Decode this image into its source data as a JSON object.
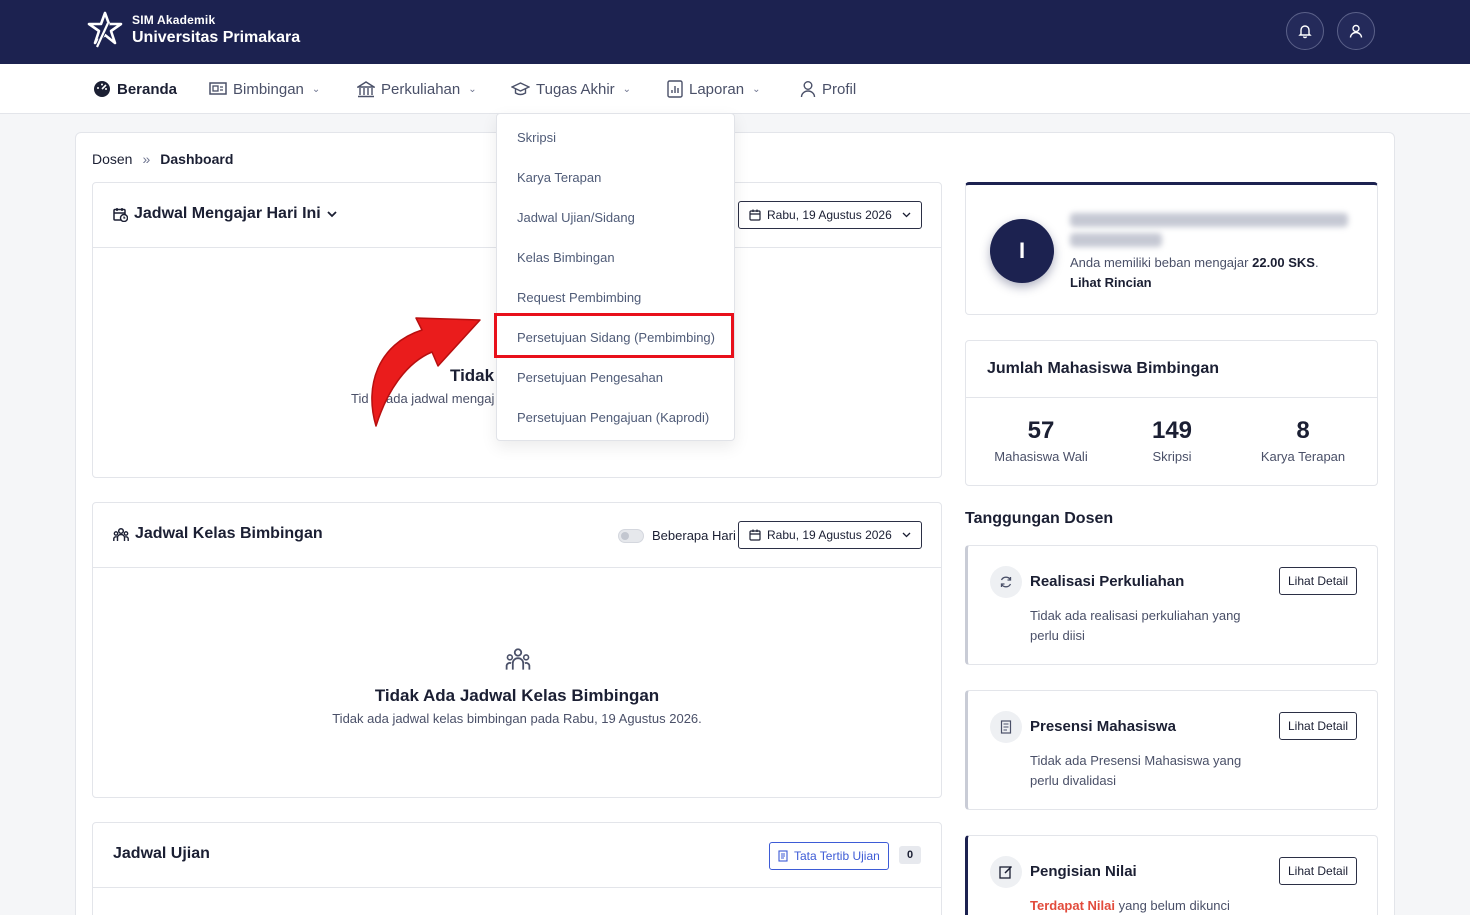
{
  "app": {
    "subtitle": "SIM Akademik",
    "title": "Universitas Primakara"
  },
  "nav": {
    "items": [
      {
        "label": "Beranda",
        "icon": "dashboard-icon",
        "has_caret": false
      },
      {
        "label": "Bimbingan",
        "icon": "board-icon",
        "has_caret": true
      },
      {
        "label": "Perkuliahan",
        "icon": "building-icon",
        "has_caret": true
      },
      {
        "label": "Tugas Akhir",
        "icon": "graduation-cap-icon",
        "has_caret": true
      },
      {
        "label": "Laporan",
        "icon": "report-icon",
        "has_caret": true
      },
      {
        "label": "Profil",
        "icon": "user-icon",
        "has_caret": false
      }
    ]
  },
  "dropdown": {
    "items": [
      "Skripsi",
      "Karya Terapan",
      "Jadwal Ujian/Sidang",
      "Kelas Bimbingan",
      "Request Pembimbing",
      "Persetujuan Sidang (Pembimbing)",
      "Persetujuan Pengesahan",
      "Persetujuan Pengajuan (Kaprodi)"
    ],
    "highlighted_index": 5,
    "highlight_color": "#e8101b"
  },
  "breadcrumb": {
    "root": "Dosen",
    "separator": "»",
    "current": "Dashboard"
  },
  "jadwal_mengajar": {
    "title": "Jadwal Mengajar Hari Ini",
    "date": "Rabu, 19 Agustus 2026",
    "empty_title_partial": "Tidak",
    "empty_sub_left": "Tid",
    "empty_sub_right": "ada jadwal mengaj"
  },
  "jadwal_kelas": {
    "title": "Jadwal Kelas Bimbingan",
    "toggle_label": "Beberapa Hari",
    "date": "Rabu, 19 Agustus 2026",
    "empty_title": "Tidak Ada Jadwal Kelas Bimbingan",
    "empty_sub": "Tidak ada jadwal kelas bimbingan pada Rabu, 19 Agustus 2026."
  },
  "jadwal_ujian": {
    "title": "Jadwal Ujian",
    "rules_button": "Tata Tertib Ujian",
    "count": "0"
  },
  "profile": {
    "avatar_initial": "I",
    "load_prefix": "Anda memiliki beban mengajar ",
    "load_value": "22.00 SKS",
    "load_suffix": ".",
    "detail_link": "Lihat Rincian"
  },
  "bimbingan_count": {
    "title": "Jumlah Mahasiswa Bimbingan",
    "stats": [
      {
        "value": "57",
        "label": "Mahasiswa Wali"
      },
      {
        "value": "149",
        "label": "Skripsi"
      },
      {
        "value": "8",
        "label": "Karya Terapan"
      }
    ]
  },
  "tanggungan": {
    "title": "Tanggungan Dosen",
    "cards": [
      {
        "title": "Realisasi Perkuliahan",
        "desc": "Tidak ada realisasi perkuliahan yang perlu diisi",
        "button": "Lihat Detail",
        "icon": "refresh-icon"
      },
      {
        "title": "Presensi Mahasiswa",
        "desc": "Tidak ada Presensi Mahasiswa yang perlu divalidasi",
        "button": "Lihat Detail",
        "icon": "document-list-icon"
      },
      {
        "title": "Pengisian Nilai",
        "desc_highlight": "Terdapat Nilai",
        "desc_rest": " yang belum dikunci",
        "button": "Lihat Detail",
        "icon": "edit-icon"
      }
    ]
  },
  "colors": {
    "brand_navy": "#1c2250",
    "accent_blue": "#3d5bd6",
    "alert_red": "#e24b3c"
  }
}
